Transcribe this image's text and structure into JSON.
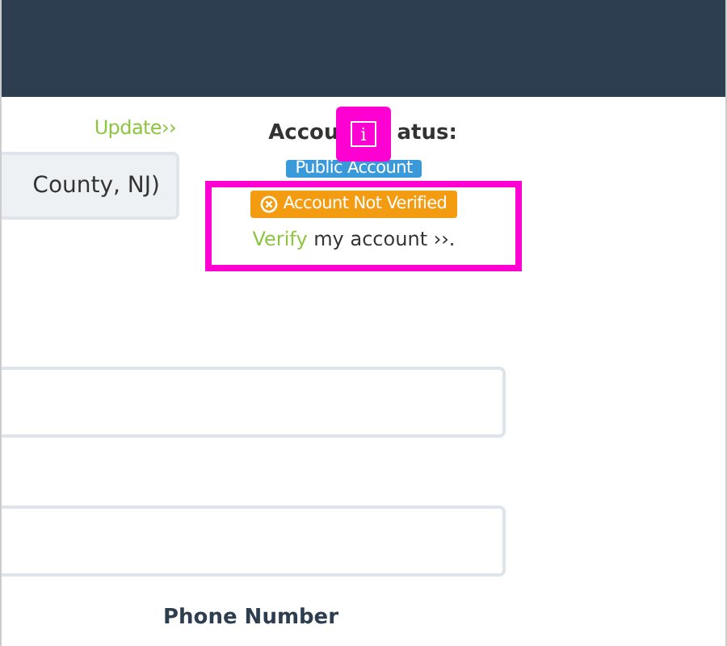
{
  "update_link": "Update››",
  "location_field": {
    "value": "County, NJ)"
  },
  "account_status": {
    "heading_parts": [
      "Accou",
      "atus:"
    ],
    "badges": [
      {
        "kind": "public",
        "label": "Public Account"
      },
      {
        "kind": "warning",
        "label": "Account Not Verified"
      }
    ],
    "verify_link": "Verify",
    "verify_text": "my account ››."
  },
  "highlight": {
    "marker": "i"
  },
  "fields": [
    {
      "kind": "text"
    },
    {
      "kind": "text"
    }
  ],
  "phone_label": "Phone Number"
}
